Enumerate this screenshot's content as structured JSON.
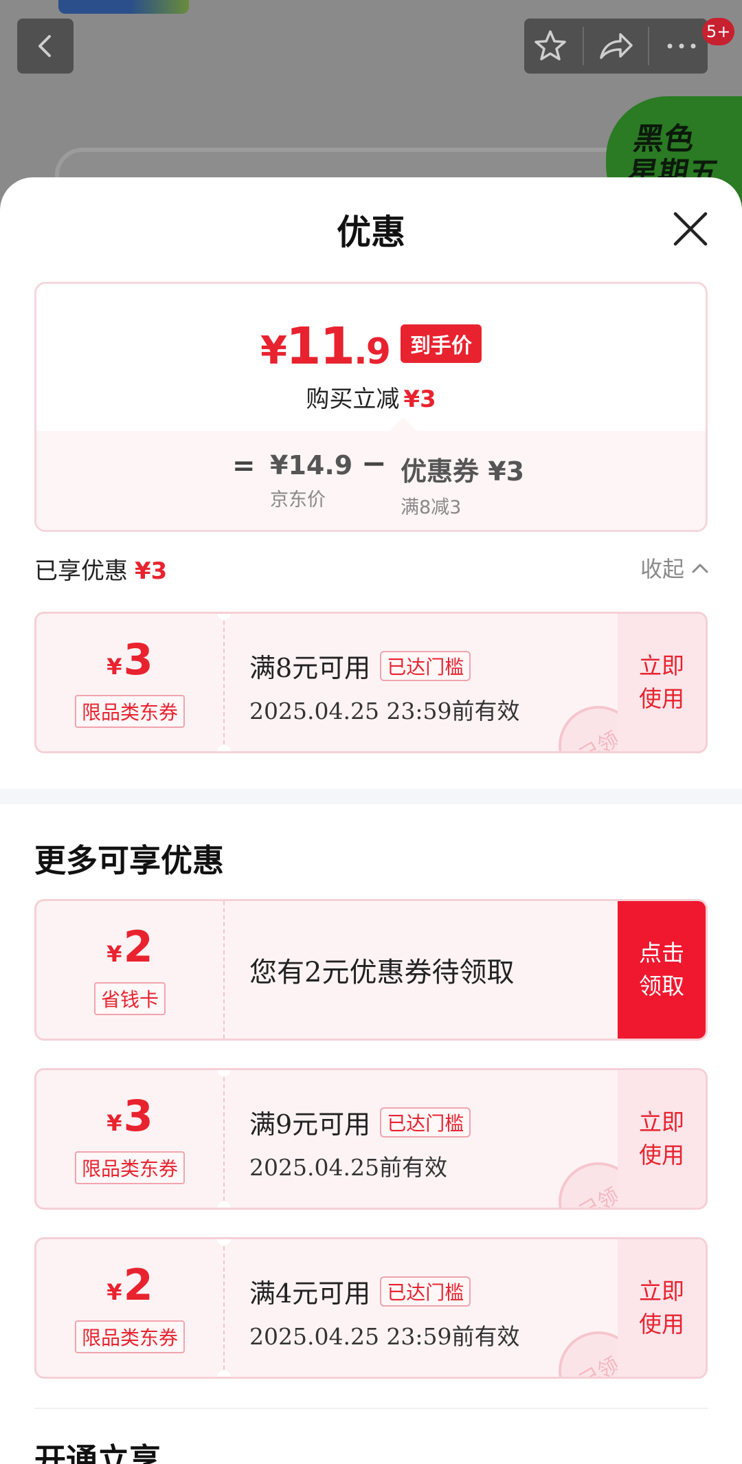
{
  "background": {
    "badge_text": "黑色\n星期五",
    "cart_count": "5+"
  },
  "icons": {
    "back": "chevron-left-icon",
    "favorite": "star-icon",
    "share": "share-arrow-icon",
    "more": "more-dots-icon",
    "close": "close-icon",
    "collapse": "chevron-up-icon"
  },
  "colors": {
    "accent": "#e8232f",
    "coupon_bg": "#fdf3f5",
    "claim_bg": "#f0182f"
  },
  "sheet": {
    "title": "优惠",
    "price": {
      "yen": "¥",
      "integer": "11",
      "decimal": ".9",
      "tag": "到手价",
      "sub_label": "购买立减",
      "sub_amount": "¥3",
      "equals": "=",
      "minus": "−",
      "jd_price": "¥14.9",
      "jd_label": "京东价",
      "coupon_value": "优惠券 ¥3",
      "coupon_rule": "满8减3"
    },
    "enjoyed": {
      "label": "已享优惠",
      "amount": "¥3",
      "collapse": "收起"
    },
    "applied_coupon": {
      "yen": "¥",
      "amount": "3",
      "type": "限品类东券",
      "condition": "满8元可用",
      "reached": "已达门槛",
      "validity": "2025.04.25 23:59前有效",
      "action": "立即\n使用",
      "stamp": "已领"
    },
    "more_title": "更多可享优惠",
    "more_coupons": [
      {
        "yen": "¥",
        "amount": "2",
        "type": "省钱卡",
        "text": "您有2元优惠券待领取",
        "action": "点击\n领取"
      },
      {
        "yen": "¥",
        "amount": "3",
        "type": "限品类东券",
        "condition": "满9元可用",
        "reached": "已达门槛",
        "validity": "2025.04.25前有效",
        "action": "立即\n使用",
        "stamp": "已领"
      },
      {
        "yen": "¥",
        "amount": "2",
        "type": "限品类东券",
        "condition": "满4元可用",
        "reached": "已达门槛",
        "validity": "2025.04.25 23:59前有效",
        "action": "立即\n使用",
        "stamp": "已领"
      }
    ],
    "open_title": "开通立享"
  }
}
